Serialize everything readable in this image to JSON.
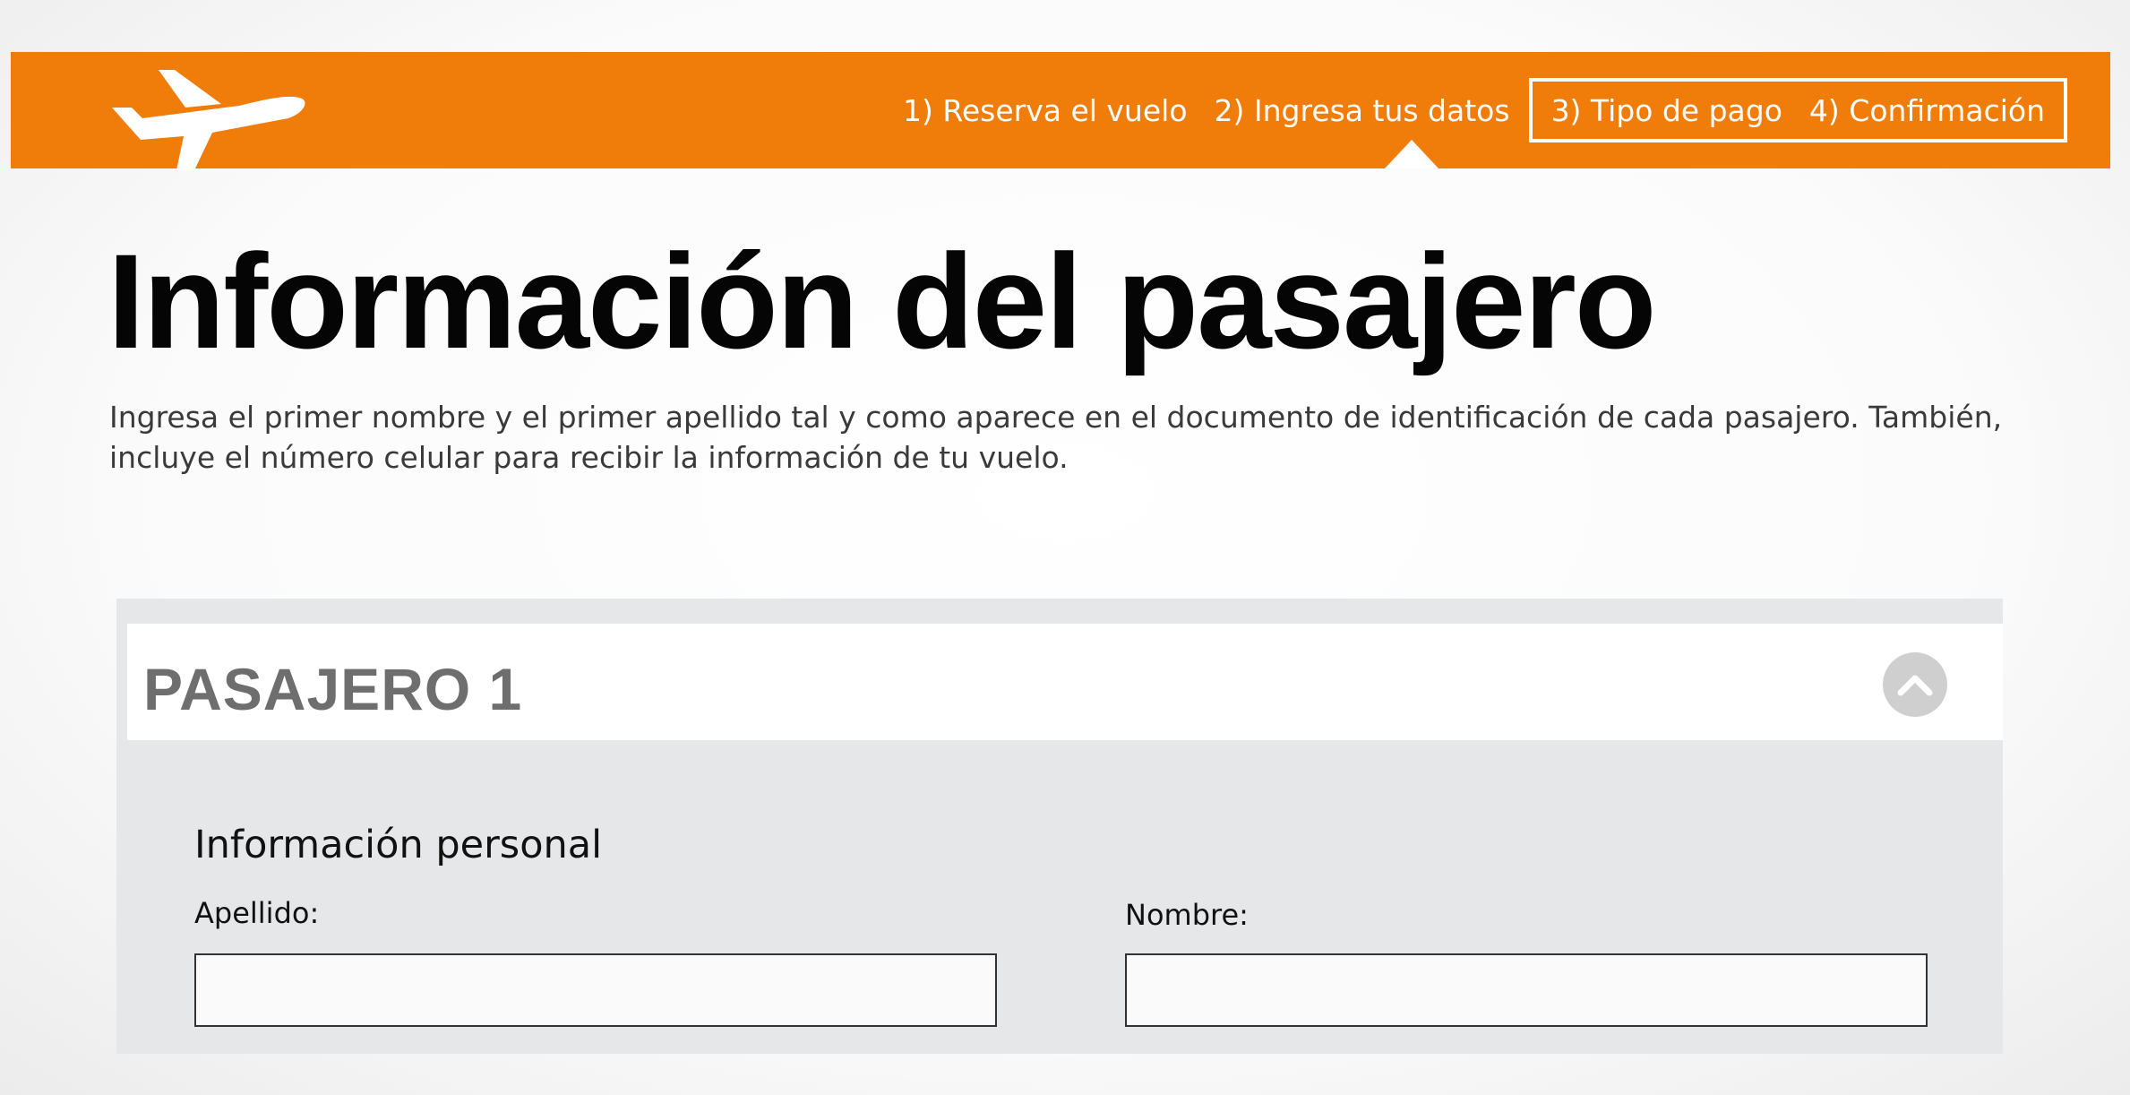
{
  "header": {
    "brand_color": "#f07c0a",
    "logo_icon": "airplane-icon",
    "steps": [
      {
        "label": "1) Reserva el vuelo",
        "state": "completed"
      },
      {
        "label": "2) Ingresa tus datos",
        "state": "current"
      },
      {
        "label": "3) Tipo de pago",
        "state": "upcoming"
      },
      {
        "label": "4) Confirmación",
        "state": "upcoming"
      }
    ]
  },
  "page": {
    "title": "Información del pasajero",
    "intro": "Ingresa el primer nombre y el primer apellido tal y como aparece en el documento de identificación de cada pasajero. También, incluye el número celular para recibir la información de tu vuelo."
  },
  "passenger_panel": {
    "title": "PASAJERO 1",
    "collapse_icon": "chevron-up-icon",
    "section_title": "Información personal",
    "fields": {
      "apellido": {
        "label": "Apellido:",
        "value": "",
        "placeholder": ""
      },
      "nombre": {
        "label": "Nombre:",
        "value": "",
        "placeholder": ""
      }
    }
  }
}
